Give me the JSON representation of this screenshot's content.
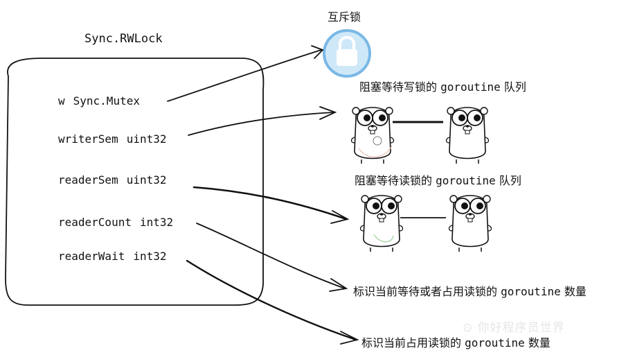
{
  "struct": {
    "title": "Sync.RWLock",
    "fields": [
      {
        "name": "w",
        "type": "Sync.Mutex"
      },
      {
        "name": "writerSem",
        "type": "uint32"
      },
      {
        "name": "readerSem",
        "type": "uint32"
      },
      {
        "name": "readerCount",
        "type": "int32"
      },
      {
        "name": "readerWait",
        "type": "int32"
      }
    ]
  },
  "labels": {
    "mutex": "互斥锁",
    "writer_queue": {
      "prefix": "阻塞等待写锁的",
      "word": "goroutine",
      "suffix": "队列"
    },
    "reader_queue": {
      "prefix": "阻塞等待读锁的",
      "word": "goroutine",
      "suffix": "队列"
    },
    "reader_count": {
      "prefix": "标识当前等待或者占用读锁的",
      "word": "goroutine",
      "suffix": "数量"
    },
    "reader_wait": {
      "prefix": "标识当前占用读锁的",
      "word": "goroutine",
      "suffix": "数量"
    }
  },
  "icons": {
    "lock": "lock-icon",
    "gopher": "gopher-icon"
  },
  "colors": {
    "lock_ring": "#7ab8e6",
    "lock_fill": "#cfe8f8",
    "stroke": "#111111"
  },
  "watermark": "⊙ 你好程序员世界"
}
